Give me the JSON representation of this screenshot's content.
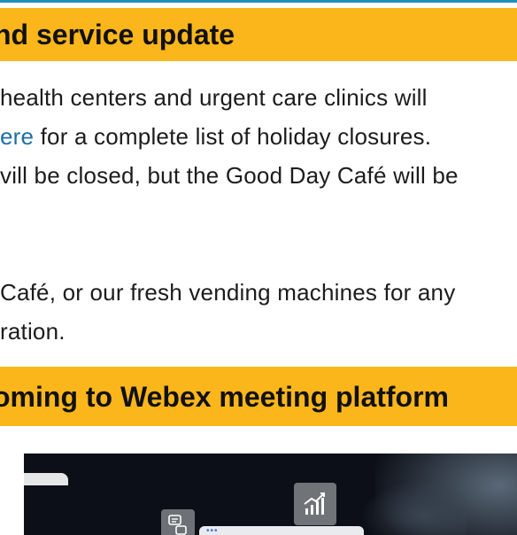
{
  "banner1": {
    "title": "nd service update"
  },
  "article1": {
    "line1": "health centers and urgent care clinics will",
    "line2_link": "ere",
    "line2_rest": " for a complete list of holiday closures.",
    "line3": "vill be closed, but the Good Day Café will be",
    "line4": "Café, or our fresh vending machines for any",
    "line5": "ration."
  },
  "banner2": {
    "title": "oming to Webex meeting platform"
  },
  "video": {
    "chart_icon": "chart-bars-up-icon",
    "chat_icon": "chat-bubbles-icon",
    "panel_dots": "•••"
  },
  "colors": {
    "accent_yellow": "#fbb61c",
    "link_blue": "#1d6fa8",
    "top_rule": "#1f8fb8"
  }
}
